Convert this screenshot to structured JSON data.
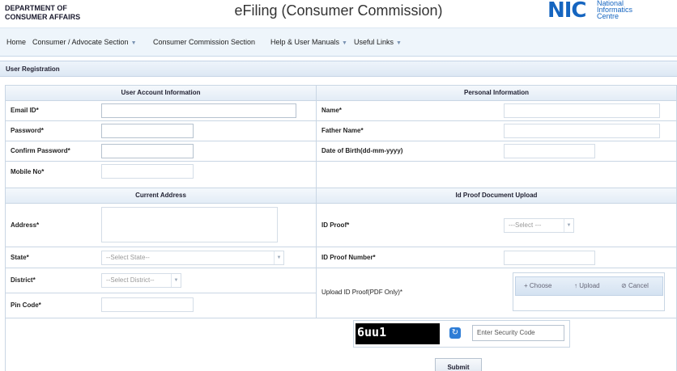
{
  "header": {
    "dept_line1": "DEPARTMENT OF",
    "dept_line2": "CONSUMER AFFAIRS",
    "title": "eFiling (Consumer Commission)",
    "logo_mark": "NIC",
    "logo_line1": "National",
    "logo_line2": "Informatics",
    "logo_line3": "Centre",
    "brand_color": "#1565c0"
  },
  "nav": {
    "home": "Home",
    "consumer": "Consumer / Advocate Section",
    "commission": "Consumer Commission Section",
    "help": "Help & User Manuals",
    "links": "Useful Links"
  },
  "section_title": "User Registration",
  "account": {
    "heading": "User Account Information",
    "email_label": "Email ID*",
    "password_label": "Password*",
    "confirm_label": "Confirm Password*",
    "mobile_label": "Mobile No*"
  },
  "personal": {
    "heading": "Personal Information",
    "name_label": "Name*",
    "father_label": "Father Name*",
    "dob_label": "Date of Birth(dd-mm-yyyy)"
  },
  "address": {
    "heading": "Current Address",
    "address_label": "Address*",
    "state_label": "State*",
    "state_placeholder": "--Select State--",
    "district_label": "District*",
    "district_placeholder": "--Select District--",
    "pin_label": "Pin Code*"
  },
  "idproof": {
    "heading": "Id Proof Document Upload",
    "proof_label": "ID Proof*",
    "proof_placeholder": "---Select ---",
    "number_label": "ID Proof Number*",
    "upload_label": "Upload ID Proof(PDF Only)*",
    "choose": "Choose",
    "upload": "Upload",
    "cancel": "Cancel"
  },
  "captcha": {
    "code": "6uu1",
    "placeholder": "Enter Security Code"
  },
  "submit_label": "Submit"
}
